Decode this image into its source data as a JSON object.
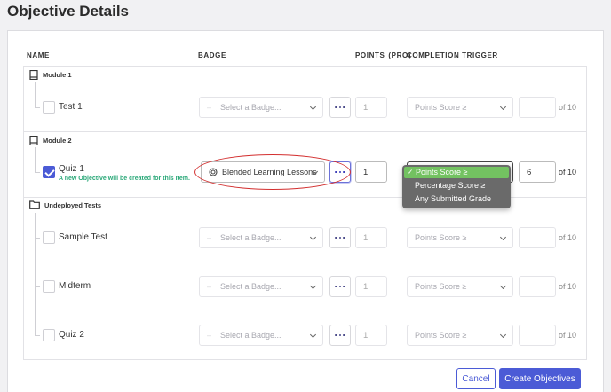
{
  "page": {
    "title": "Objective Details"
  },
  "columns": {
    "name": "NAME",
    "badge": "BADGE",
    "points": "POINTS",
    "pro": "(PRO)",
    "trigger": "COMPLETION TRIGGER"
  },
  "groups": [
    {
      "title": "Module 1",
      "icon": "book-icon"
    },
    {
      "title": "Module 2",
      "icon": "book-icon"
    },
    {
      "title": "Undeployed Tests",
      "icon": "folder-icon"
    }
  ],
  "items": [
    {
      "name": "Test 1",
      "checked": false,
      "badge": "Select a Badge...",
      "points": "1",
      "trigger": "Points Score ≥",
      "score": "",
      "of": "of 10"
    },
    {
      "name": "Quiz 1",
      "checked": true,
      "note": "A new Objective will be created for this Item.",
      "badge": "Blended Learning Lessons",
      "points": "1",
      "trigger": "Points Score ≥",
      "score": "6",
      "of": "of 10"
    },
    {
      "name": "Sample Test",
      "checked": false,
      "badge": "Select a Badge...",
      "points": "1",
      "trigger": "Points Score ≥",
      "score": "",
      "of": "of 10"
    },
    {
      "name": "Midterm",
      "checked": false,
      "badge": "Select a Badge...",
      "points": "1",
      "trigger": "Points Score ≥",
      "score": "",
      "of": "of 10"
    },
    {
      "name": "Quiz 2",
      "checked": false,
      "badge": "Select a Badge...",
      "points": "1",
      "trigger": "Points Score ≥",
      "score": "",
      "of": "of 10"
    }
  ],
  "trigger_options": [
    "✓ Points Score ≥",
    "Percentage Score ≥",
    "Any Submitted Grade"
  ],
  "buttons": {
    "cancel": "Cancel",
    "create": "Create Objectives"
  },
  "colors": {
    "accent": "#4b5bd6",
    "note": "#2aa878",
    "annotation": "#d32f2f",
    "selected_option": "#73c261"
  }
}
